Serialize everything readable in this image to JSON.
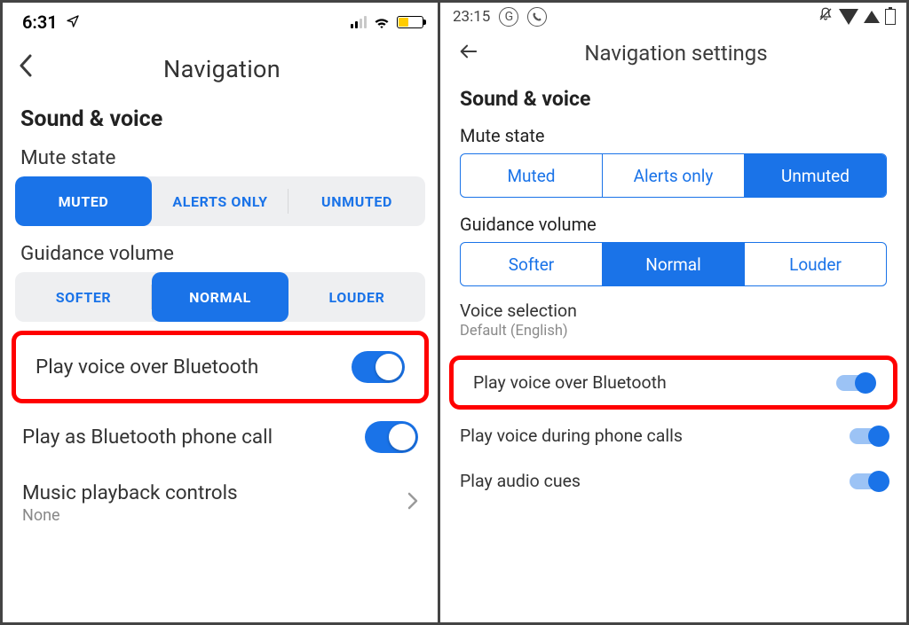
{
  "left": {
    "status_time": "6:31",
    "header_title": "Navigation",
    "section": "Sound & voice",
    "mute_label": "Mute state",
    "mute_options": {
      "a": "MUTED",
      "b": "ALERTS ONLY",
      "c": "UNMUTED"
    },
    "mute_active": "a",
    "vol_label": "Guidance volume",
    "vol_options": {
      "a": "SOFTER",
      "b": "NORMAL",
      "c": "LOUDER"
    },
    "vol_active": "b",
    "bt_label": "Play voice over Bluetooth",
    "bt_on": true,
    "phonecall_label": "Play as Bluetooth phone call",
    "phonecall_on": true,
    "music_label": "Music playback controls",
    "music_value": "None"
  },
  "right": {
    "status_time": "23:15",
    "header_title": "Navigation settings",
    "section": "Sound & voice",
    "mute_label": "Mute state",
    "mute_options": {
      "a": "Muted",
      "b": "Alerts only",
      "c": "Unmuted"
    },
    "mute_active": "c",
    "vol_label": "Guidance volume",
    "vol_options": {
      "a": "Softer",
      "b": "Normal",
      "c": "Louder"
    },
    "vol_active": "b",
    "voice_sel_label": "Voice selection",
    "voice_sel_value": "Default (English)",
    "bt_label": "Play voice over Bluetooth",
    "bt_on": true,
    "during_calls_label": "Play voice during phone calls",
    "during_calls_on": true,
    "audio_cues_label": "Play audio cues",
    "audio_cues_on": true
  }
}
